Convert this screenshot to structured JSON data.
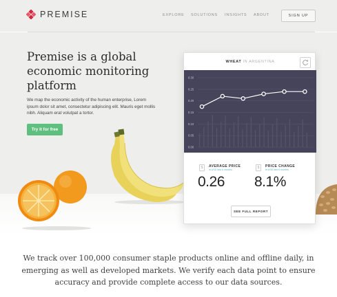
{
  "brand": {
    "name": "PREMISE",
    "accent": "#d6263d"
  },
  "nav": {
    "items": [
      {
        "label": "EXPLORE"
      },
      {
        "label": "SOLUTIONS"
      },
      {
        "label": "INSIGHTS"
      },
      {
        "label": "ABOUT"
      }
    ],
    "signup_label": "SIGN UP"
  },
  "hero": {
    "title_lines": [
      "Premise is a global",
      "economic monitoring",
      "platform"
    ],
    "body_lines": [
      "We map the economic activity of the human enterprise, Lorem",
      "ipsum dolor sit amet, consectetur adipiscing elit. Mauris eget mollis",
      "nibh. Aliquam erat volutpat a tortor."
    ],
    "cta_label": "Try it for free",
    "cta_color": "#5fbf7f"
  },
  "widget": {
    "title_main": "WHEAT",
    "title_rest": " IN ARGENTINA",
    "refresh_icon": "refresh-icon",
    "chart_bg": "#45445a",
    "stats": [
      {
        "label": "AVERAGE PRICE",
        "sub": "in USD last 6 months",
        "value": "0.26"
      },
      {
        "label": "PRICE CHANGE",
        "sub": "in USD last 6 months",
        "value": "8.1%"
      }
    ],
    "report_label": "SEE FULL REPORT"
  },
  "chart_data": {
    "type": "line",
    "title": "",
    "xlabel": "",
    "ylabel": "",
    "yticks": [
      "0.30",
      "0.25",
      "0.20",
      "0.15",
      "0.10",
      "0.05",
      "0.00"
    ],
    "ylim": [
      0,
      0.3
    ],
    "series": [
      {
        "values": [
          0.175,
          0.22,
          0.21,
          0.23,
          0.24,
          0.24
        ]
      }
    ],
    "grid": true
  },
  "tagline": {
    "lines": [
      "We track over 100,000 consumer staple products online and offline daily, in",
      "emerging as well as developed markets. We verify each data point to ensure",
      "accuracy and provide complete access to our data sources."
    ]
  }
}
